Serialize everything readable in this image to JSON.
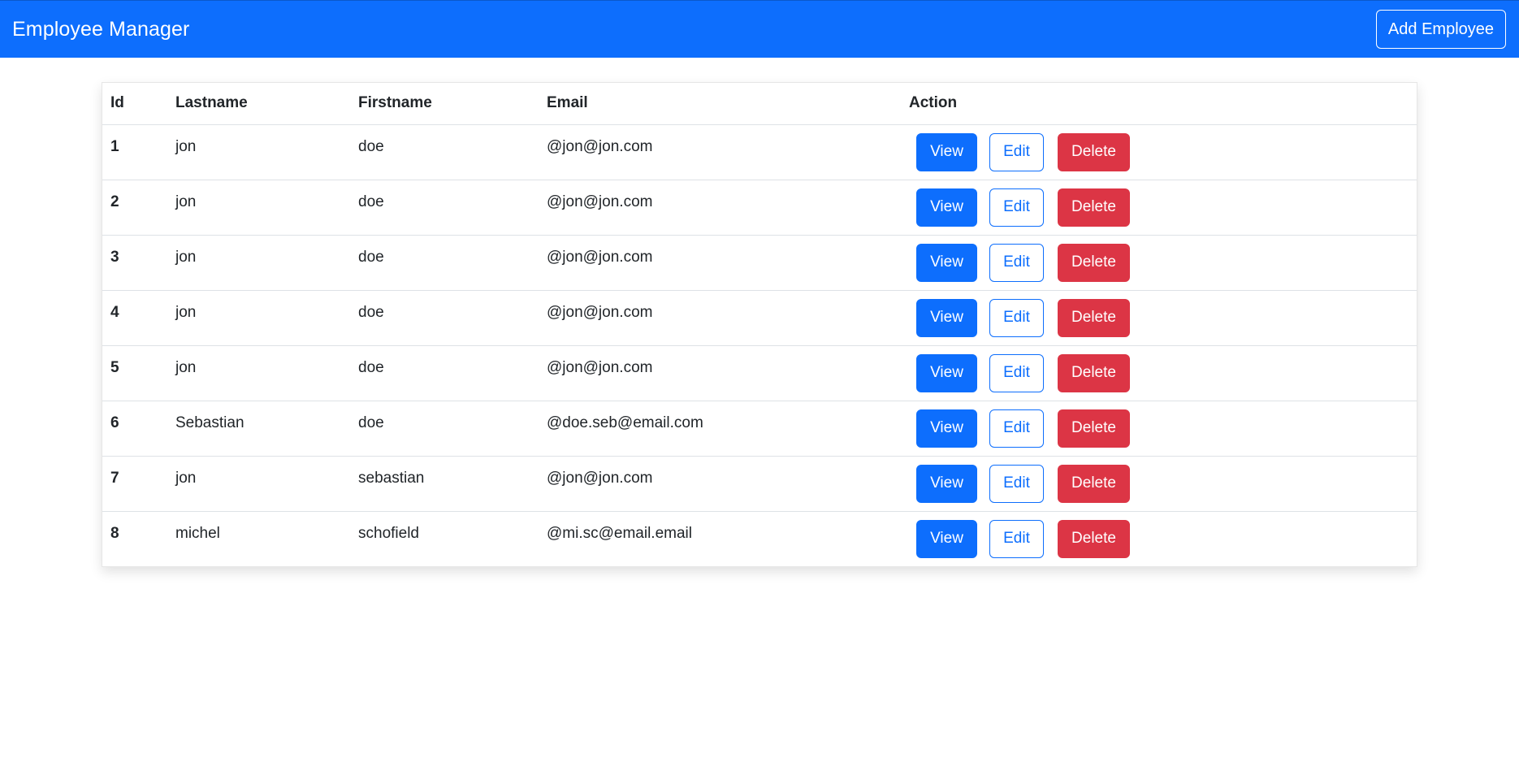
{
  "navbar": {
    "brand": "Employee Manager",
    "add_button_label": "Add Employee",
    "background_color": "#0d6efd"
  },
  "table": {
    "headers": {
      "id": "Id",
      "lastname": "Lastname",
      "firstname": "Firstname",
      "email": "Email",
      "action": "Action"
    },
    "actions": {
      "view": "View",
      "edit": "Edit",
      "delete": "Delete"
    },
    "rows": [
      {
        "id": "1",
        "lastname": "jon",
        "firstname": "doe",
        "email": "@jon@jon.com"
      },
      {
        "id": "2",
        "lastname": "jon",
        "firstname": "doe",
        "email": "@jon@jon.com"
      },
      {
        "id": "3",
        "lastname": "jon",
        "firstname": "doe",
        "email": "@jon@jon.com"
      },
      {
        "id": "4",
        "lastname": "jon",
        "firstname": "doe",
        "email": "@jon@jon.com"
      },
      {
        "id": "5",
        "lastname": "jon",
        "firstname": "doe",
        "email": "@jon@jon.com"
      },
      {
        "id": "6",
        "lastname": "Sebastian",
        "firstname": "doe",
        "email": "@doe.seb@email.com"
      },
      {
        "id": "7",
        "lastname": "jon",
        "firstname": "sebastian",
        "email": "@jon@jon.com"
      },
      {
        "id": "8",
        "lastname": "michel",
        "firstname": "schofield",
        "email": "@mi.sc@email.email"
      }
    ]
  },
  "colors": {
    "primary": "#0d6efd",
    "danger": "#dc3545"
  }
}
